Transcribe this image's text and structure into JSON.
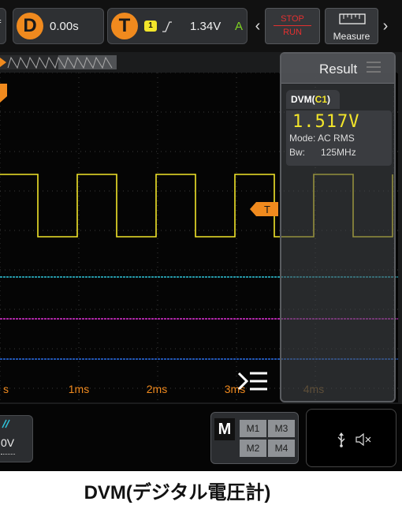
{
  "topbar": {
    "left_glyph": "f",
    "delay_button": "D",
    "delay_value": "0.00s",
    "trigger_button": "T",
    "trigger_channel": "1",
    "trigger_edge_icon": "rising-edge-icon",
    "trigger_level": "1.34V",
    "trigger_mode": "A",
    "stop_label": "STOP",
    "run_label": "RUN",
    "measure_label": "Measure"
  },
  "waveform": {
    "trigger_marker": "T",
    "time_labels": [
      "s",
      "1ms",
      "2ms",
      "3ms",
      "4ms"
    ],
    "channel_colors": [
      "#f2e52a",
      "#2ec3d8",
      "#e030d8",
      "#2b6fe8"
    ]
  },
  "result_panel": {
    "title": "Result",
    "dvm_label": "DVM(",
    "dvm_channel": "C1",
    "dvm_close": ")",
    "dvm_value": "1.517V",
    "mode_line": "Mode: AC RMS",
    "bw_label": "Bw:",
    "bw_value": "125MHz"
  },
  "bottom": {
    "channel_partial": "0V",
    "m_label": "M",
    "memories": [
      "M1",
      "M3",
      "M2",
      "M4"
    ]
  },
  "caption": "DVM(デジタル電圧計)",
  "colors": {
    "accent": "#f08a1e",
    "ch1": "#f2e52a",
    "stop": "#e33030"
  }
}
